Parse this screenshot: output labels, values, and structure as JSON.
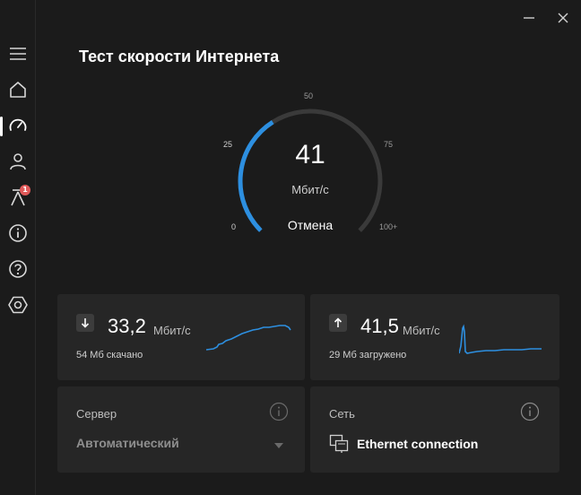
{
  "window": {
    "minimize_icon": "minimize-icon",
    "close_icon": "close-icon"
  },
  "sidebar": {
    "items": [
      {
        "name": "menu",
        "icon": "hamburger-icon"
      },
      {
        "name": "home",
        "icon": "home-icon"
      },
      {
        "name": "speed",
        "icon": "speedometer-icon",
        "active": true
      },
      {
        "name": "account",
        "icon": "person-icon"
      },
      {
        "name": "alerts",
        "icon": "antenna-icon",
        "badge": "1"
      },
      {
        "name": "info",
        "icon": "info-icon"
      },
      {
        "name": "help",
        "icon": "help-icon"
      },
      {
        "name": "settings",
        "icon": "settings-icon"
      }
    ]
  },
  "header": {
    "title": "Тест скорости Интернета"
  },
  "gauge": {
    "value": "41",
    "unit": "Мбит/с",
    "cancel_label": "Отмена",
    "scale": [
      "0",
      "25",
      "50",
      "75",
      "100+"
    ],
    "progress_fraction": 0.38,
    "accent": "#2d8fe0",
    "track": "#3a3a3a"
  },
  "download": {
    "value": "33,2",
    "unit": "Мбит/с",
    "sub": "54 Мб скачано"
  },
  "upload": {
    "value": "41,5",
    "unit": "Мбит/с",
    "sub": "29 Мб загружено"
  },
  "server": {
    "label": "Сервер",
    "value": "Автоматический"
  },
  "network": {
    "label": "Сеть",
    "value": "Ethernet connection"
  }
}
